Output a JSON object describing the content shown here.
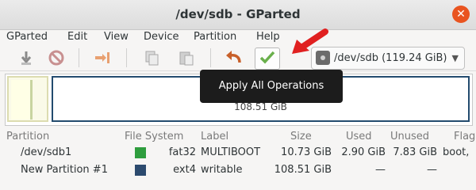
{
  "window": {
    "title": "/dev/sdb - GParted",
    "close_icon": "close-icon"
  },
  "menu": [
    "GParted",
    "Edit",
    "View",
    "Device",
    "Partition",
    "Help"
  ],
  "toolbar": {
    "apply_tooltip": "Apply All Operations",
    "icons": [
      "new-icon",
      "delete-icon",
      "resize-icon",
      "copy-icon",
      "paste-icon",
      "undo-icon",
      "apply-icon"
    ]
  },
  "device_selector": {
    "label": "/dev/sdb (119.24 GiB)",
    "icon": "drive-icon",
    "arrow_icon": "chevron-down-icon"
  },
  "disk_map": {
    "partition2_label": "108.51 GiB"
  },
  "table": {
    "headers": [
      "Partition",
      "File System",
      "Label",
      "Size",
      "Used",
      "Unused",
      "Flags"
    ],
    "rows": [
      {
        "partition": "/dev/sdb1",
        "fs": "fat32",
        "fs_color": "#2e9d3e",
        "label": "MULTIBOOT",
        "size": "10.73 GiB",
        "used": "2.90 GiB",
        "unused": "7.83 GiB",
        "flags": "boot,"
      },
      {
        "partition": "New Partition #1",
        "fs": "ext4",
        "fs_color": "#2c4a6e",
        "label": "writable",
        "size": "108.51 GiB",
        "used": "—",
        "unused": "—",
        "flags": ""
      }
    ]
  },
  "colors": {
    "accent_close": "#e95420",
    "annotation_arrow": "#e02020"
  }
}
